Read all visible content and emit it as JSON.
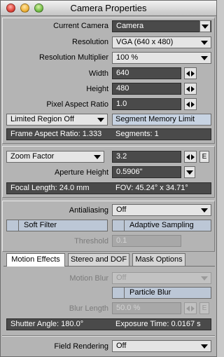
{
  "window": {
    "title": "Camera Properties"
  },
  "camera": {
    "current_camera_label": "Current Camera",
    "current_camera_value": "Camera",
    "resolution_label": "Resolution",
    "resolution_value": "VGA (640 x 480)",
    "resolution_multiplier_label": "Resolution Multiplier",
    "resolution_multiplier_value": "100 %",
    "width_label": "Width",
    "width_value": "640",
    "height_label": "Height",
    "height_value": "480",
    "pixel_aspect_label": "Pixel Aspect Ratio",
    "pixel_aspect_value": "1.0",
    "limited_region_value": "Limited Region Off",
    "segment_memory_label": "Segment Memory Limit",
    "frame_aspect_text": "Frame Aspect Ratio: 1.333",
    "segments_text": "Segments: 1"
  },
  "lens": {
    "zoom_factor_value": "Zoom Factor",
    "zoom_value": "3.2",
    "e_button": "E",
    "aperture_height_label": "Aperture Height",
    "aperture_height_value": "0.5906\"",
    "focal_length_text": "Focal Length: 24.0 mm",
    "fov_text": "FOV: 45.24° x 34.71°"
  },
  "antialias": {
    "antialiasing_label": "Antialiasing",
    "antialiasing_value": "Off",
    "soft_filter_label": "Soft Filter",
    "adaptive_sampling_label": "Adaptive Sampling",
    "threshold_label": "Threshold",
    "threshold_value": "0.1"
  },
  "tabs": [
    {
      "label": "Motion Effects",
      "active": true
    },
    {
      "label": "Stereo and DOF",
      "active": false
    },
    {
      "label": "Mask Options",
      "active": false
    }
  ],
  "motion": {
    "motion_blur_label": "Motion Blur",
    "motion_blur_value": "Off",
    "particle_blur_label": "Particle Blur",
    "blur_length_label": "Blur Length",
    "blur_length_value": "50.0 %",
    "e_button": "E",
    "shutter_angle_text": "Shutter Angle: 180.0°",
    "exposure_time_text": "Exposure Time: 0.0167 s"
  },
  "field": {
    "field_rendering_label": "Field Rendering",
    "field_rendering_value": "Off"
  }
}
